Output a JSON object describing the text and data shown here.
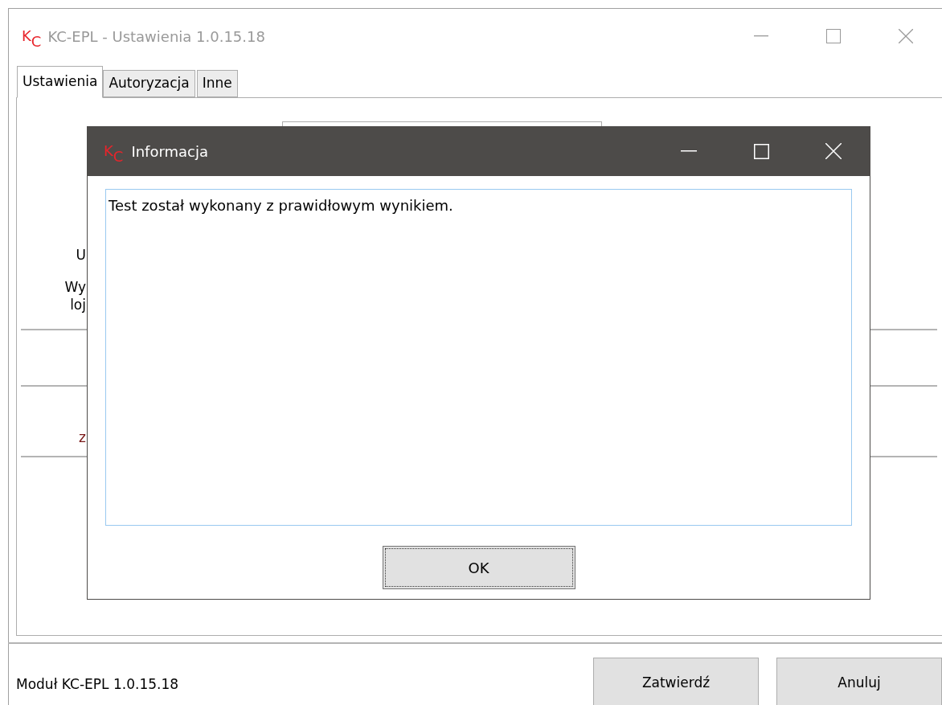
{
  "window": {
    "logo_text": "KC",
    "title": "KC-EPL - Ustawienia 1.0.15.18"
  },
  "tabs": [
    {
      "label": "Ustawienia",
      "selected": true
    },
    {
      "label": "Autoryzacja",
      "selected": false
    },
    {
      "label": "Inne",
      "selected": false
    }
  ],
  "settings_fragments": [
    {
      "kind": "label",
      "text": "U"
    },
    {
      "kind": "label",
      "text": "Wy"
    },
    {
      "kind": "label",
      "text": "loj"
    },
    {
      "kind": "accent",
      "text": "z"
    }
  ],
  "dialog": {
    "logo_text": "KC",
    "title": "Informacja",
    "message": "Test został wykonany z prawidłowym wynikiem.",
    "button": "OK"
  },
  "status_bar": {
    "text": "Moduł KC-EPL 1.0.15.18"
  },
  "buttons": [
    {
      "label": "Zatwierdź"
    },
    {
      "label": "Anuluj"
    }
  ]
}
